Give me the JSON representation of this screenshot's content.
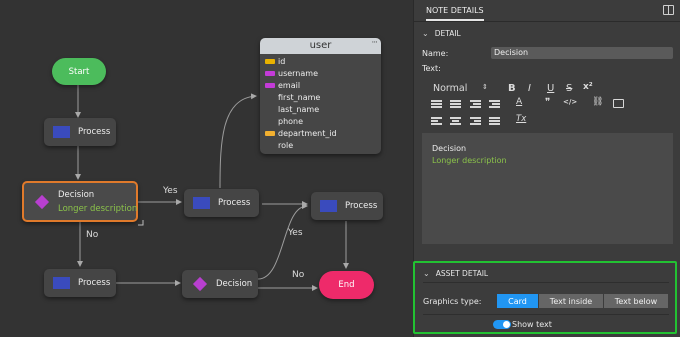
{
  "canvas": {
    "start_label": "Start",
    "end_label": "End",
    "process_label": "Process",
    "decision_title": "Decision",
    "decision_description": "Longer description",
    "edge_yes": "Yes",
    "edge_no": "No",
    "colors": {
      "process_icon": "#3a4bbd",
      "decision_icon": "#b83fd0",
      "start": "#4cbc5c",
      "end": "#ee2a6a",
      "selection": "#e07a2b",
      "description": "#8bc34a"
    },
    "table": {
      "name": "user",
      "menu_icon": "dots-icon",
      "columns": [
        {
          "name": "id",
          "key": "primary"
        },
        {
          "name": "username",
          "key": "unique"
        },
        {
          "name": "email",
          "key": "unique"
        },
        {
          "name": "first_name",
          "key": ""
        },
        {
          "name": "last_name",
          "key": ""
        },
        {
          "name": "phone",
          "key": ""
        },
        {
          "name": "department_id",
          "key": "foreign"
        },
        {
          "name": "role",
          "key": ""
        }
      ]
    }
  },
  "panel": {
    "tab": "NOTE DETAILS",
    "detail_section": "DETAIL",
    "name_label": "Name:",
    "name_value": "Decision",
    "text_label": "Text:",
    "format_select": "Normal",
    "toolbar": {
      "bold": "B",
      "italic": "I",
      "underline": "U",
      "strike": "S",
      "superscript": "x²",
      "color": "A",
      "quote": "❞",
      "code": "</>",
      "clear": "Tx"
    },
    "editor_lines": [
      "Decision",
      "Longer description"
    ],
    "asset_section": "ASSET DETAIL",
    "graphics_label": "Graphics type:",
    "graphics_options": [
      "Card",
      "Text inside",
      "Text below"
    ],
    "graphics_selected": "Card",
    "show_text_label": "Show text",
    "show_text_on": true,
    "colors": {
      "accent": "#2196f3",
      "highlight_border": "#22c232"
    }
  }
}
